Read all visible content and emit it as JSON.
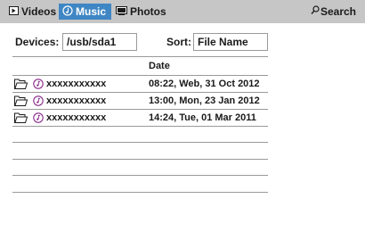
{
  "tabs": [
    {
      "label": "Videos",
      "icon": "video-icon"
    },
    {
      "label": "Music",
      "icon": "music-disc-icon",
      "active": true
    },
    {
      "label": "Photos",
      "icon": "photo-icon"
    }
  ],
  "search": {
    "label": "Search",
    "icon": "search-icon"
  },
  "filters": {
    "devices_label": "Devices:",
    "devices_value": "/usb/sda1",
    "sort_label": "Sort:",
    "sort_value": "File Name"
  },
  "table": {
    "date_header": "Date",
    "rows": [
      {
        "name": "xxxxxxxxxxx",
        "date": "08:22, Web, 31 Oct 2012"
      },
      {
        "name": "xxxxxxxxxxx",
        "date": "13:00, Mon, 23 Jan 2012"
      },
      {
        "name": "xxxxxxxxxxx",
        "date": "14:24, Tue, 01 Mar 2011"
      }
    ]
  },
  "colors": {
    "topbar": "#c6c6c6",
    "active_tab": "#3f86c4",
    "music_icon": "#8a2a8a",
    "divider": "#9a9a9a"
  }
}
